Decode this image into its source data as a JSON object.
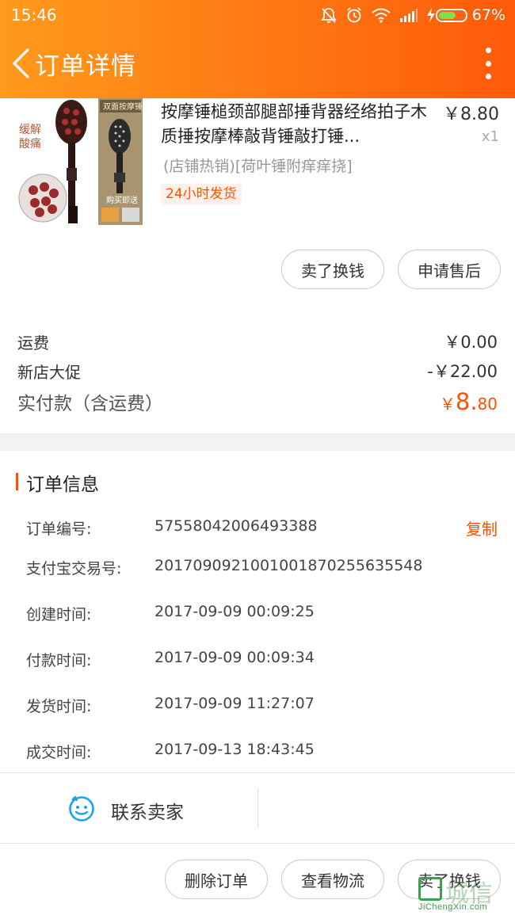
{
  "status_bar": {
    "time": "15:46",
    "battery": "67%",
    "battery_level": 0.67
  },
  "nav": {
    "title": "订单详情"
  },
  "product": {
    "title": "按摩锤槌颈部腿部捶背器经络拍子木质捶按摩棒敲背锤敲打锤...",
    "price": "￥8.80",
    "quantity": "x1",
    "spec": "(店铺热销)[荷叶锤附痒痒挠]",
    "shipping_tag": "24小时发货",
    "image_text": {
      "left_caption": "缓解酸痛",
      "right_caption": "双面按摩锤",
      "buy_note": "购买即送"
    },
    "buttons": {
      "sell": "卖了换钱",
      "after_sale": "申请售后"
    }
  },
  "fees": {
    "shipping_label": "运费",
    "shipping_value": "￥0.00",
    "promo_label": "新店大促",
    "promo_value": "-￥22.00",
    "total_label": "实付款（含运费）",
    "total_currency": "￥",
    "total_int": "8.",
    "total_dec": "80"
  },
  "order_info": {
    "title": "订单信息",
    "copy_label": "复制",
    "rows": [
      {
        "label": "订单编号:",
        "value": "57558042006493388"
      },
      {
        "label": "支付宝交易号:",
        "value": "2017090921001001870255635548"
      },
      {
        "label": "创建时间:",
        "value": "2017-09-09 00:09:25"
      },
      {
        "label": "付款时间:",
        "value": "2017-09-09 00:09:34"
      },
      {
        "label": "发货时间:",
        "value": "2017-09-09 11:27:07"
      },
      {
        "label": "成交时间:",
        "value": "2017-09-13 18:43:45"
      }
    ]
  },
  "contact": {
    "label": "联系卖家"
  },
  "bottom_actions": {
    "delete": "删除订单",
    "logistics": "查看物流",
    "sell": "卖了换钱"
  },
  "watermark": {
    "text": "城信",
    "url": "JiChengXin.com"
  },
  "colors": {
    "accent": "#ff5000",
    "header_start": "#ff9a1c",
    "header_end": "#ff5a0a"
  },
  "icons": [
    "back-icon",
    "more-icon",
    "mute-icon",
    "alarm-icon",
    "wifi-icon",
    "signal-icon",
    "charging-icon",
    "battery-icon",
    "chat-face-icon"
  ]
}
